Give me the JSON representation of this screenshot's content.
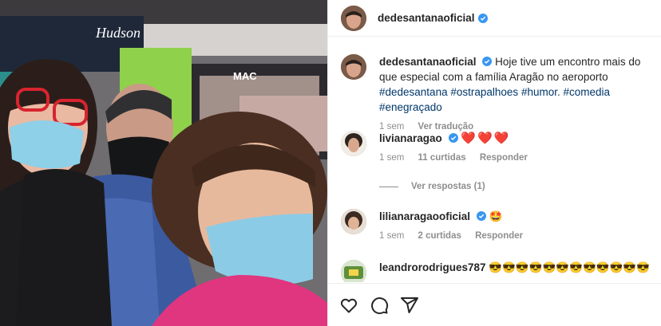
{
  "post": {
    "username": "dedesantanaoficial",
    "verified": true
  },
  "caption": {
    "username": "dedesantanaoficial",
    "text": "Hoje tive um encontro mais do que especial com a família Aragão no aeroporto",
    "hashtags": [
      "#dedesantana",
      "#ostrapalhoes",
      "#humor.",
      "#comedia",
      "#enegraçado"
    ],
    "time": "1 sem",
    "translate": "Ver tradução"
  },
  "comments": [
    {
      "username": "livianaragao",
      "text": "❤️❤️❤️",
      "time": "1 sem",
      "likes": "11 curtidas",
      "reply": "Responder",
      "view_replies": "Ver respostas (1)"
    },
    {
      "username": "lilianaragaooficial",
      "text": "🤩",
      "time": "1 sem",
      "likes": "2 curtidas",
      "reply": "Responder"
    },
    {
      "username": "leandrorodrigues787",
      "text": "😎😎😎😎😎😎😎😎😎😎😎😎"
    }
  ],
  "photo": {
    "store_signs": [
      "Hudson",
      "MAC"
    ]
  },
  "icons": {
    "like": "heart-icon",
    "comment": "comment-icon",
    "share": "share-icon",
    "verified": "verified-badge-icon"
  },
  "colors": {
    "hashtag": "#00376b",
    "verified": "#3897f0",
    "muted": "#8e8e8e"
  }
}
